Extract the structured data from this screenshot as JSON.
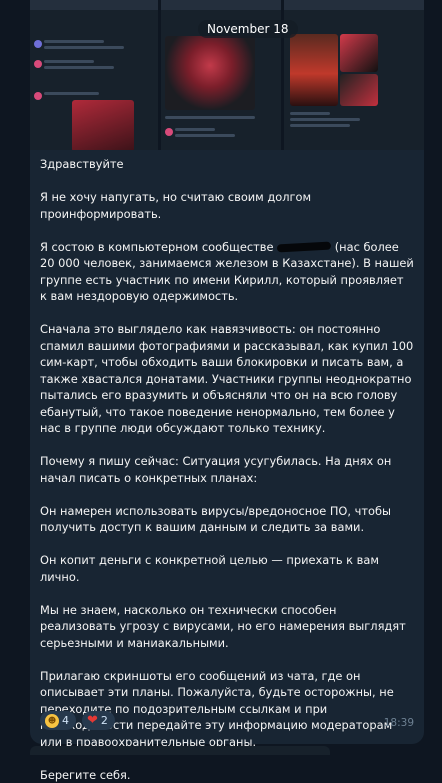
{
  "header": {
    "date": "November 18"
  },
  "message": {
    "paragraphs": [
      "Здравствуйте",
      "Я не хочу напугать, но считаю своим долгом проинформировать.",
      "Я состою в компьютерном сообществе",
      "(нас более 20 000 человек, занимаемся железом в Казахстане). В нашей группе есть участник по имени Кирилл, который проявляет к вам нездоровую одержимость.",
      "Сначала это выглядело как навязчивость: он постоянно спамил вашими фотографиями и рассказывал, как купил 100 сим-карт, чтобы обходить ваши блокировки и писать вам, а также хвастался донатами. Участники группы неоднократно пытались его вразумить и объясняли что он на всю голову ебанутый, что такое поведение ненормально, тем более у нас в группе люди обсуждают только технику.",
      "Почему я пишу сейчас: Ситуация усугубилась. На днях он начал писать о конкретных планах:",
      "Он намерен использовать вирусы/вредоносное ПО, чтобы получить доступ к вашим данным и следить за вами.",
      "Он копит деньги с конкретной целью — приехать к вам лично.",
      "Мы не знаем, насколько он технически способен реализовать угрозу с вирусами, но его намерения выглядят серьезными и маниакальными.",
      "Прилагаю скриншоты его сообщений из чата, где он описывает эти планы. Пожалуйста, будьте осторожны, не переходите по подозрительным ссылкам и при необходимости передайте эту информацию модераторам или в правоохранительные органы.",
      "Берегите себя."
    ],
    "reactions": [
      {
        "emoji": "grinning-sweat-face",
        "count": "4"
      },
      {
        "emoji": "red-heart",
        "count": "2"
      }
    ],
    "time": "18:39"
  },
  "colors": {
    "background": "#0e1621",
    "bubble": "#182533",
    "reaction_pill": "#26394d",
    "text": "#f5f5f5",
    "time": "#6d8092"
  }
}
